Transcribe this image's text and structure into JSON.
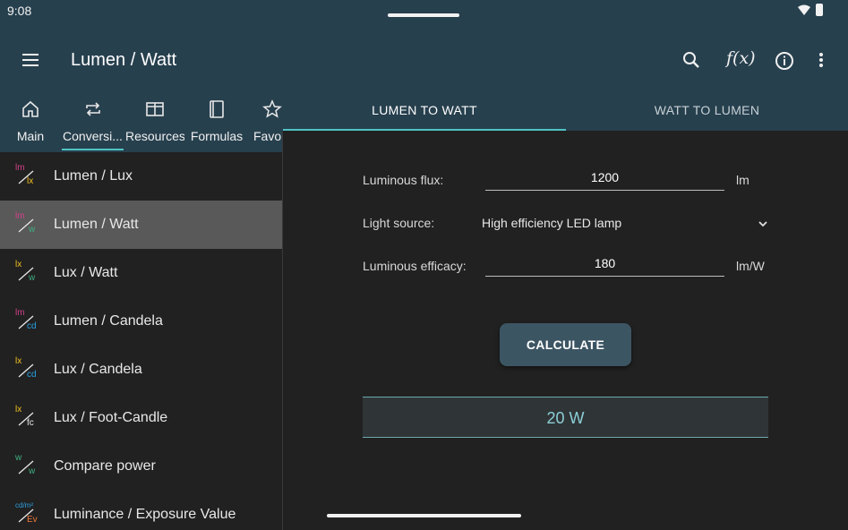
{
  "status": {
    "time": "9:08"
  },
  "app": {
    "title": "Lumen / Watt",
    "fx_label": "f(x)"
  },
  "nav_tabs": [
    {
      "label": "Main",
      "icon": "home-icon"
    },
    {
      "label": "Conversi...",
      "icon": "repeat-icon",
      "active": true
    },
    {
      "label": "Resources",
      "icon": "table-icon"
    },
    {
      "label": "Formulas",
      "icon": "book-icon"
    },
    {
      "label": "Favor",
      "icon": "star-icon"
    }
  ],
  "sub_tabs": [
    {
      "label": "LUMEN TO WATT",
      "active": true
    },
    {
      "label": "WATT TO LUMEN"
    }
  ],
  "sidebar": {
    "items": [
      {
        "label": "Lumen / Lux",
        "top": "lm",
        "bottom": "lx",
        "top_color": "#d0408a",
        "bottom_color": "#f0c020"
      },
      {
        "label": "Lumen / Watt",
        "top": "lm",
        "bottom": "w",
        "top_color": "#d0408a",
        "bottom_color": "#3fae80",
        "selected": true
      },
      {
        "label": "Lux / Watt",
        "top": "lx",
        "bottom": "w",
        "top_color": "#f0c020",
        "bottom_color": "#3fae80"
      },
      {
        "label": "Lumen / Candela",
        "top": "lm",
        "bottom": "cd",
        "top_color": "#d0408a",
        "bottom_color": "#2a9fe0"
      },
      {
        "label": "Lux / Candela",
        "top": "lx",
        "bottom": "cd",
        "top_color": "#f0c020",
        "bottom_color": "#2a9fe0"
      },
      {
        "label": "Lux / Foot-Candle",
        "top": "lx",
        "bottom": "fc",
        "top_color": "#f0c020",
        "bottom_color": "#e8e8e8"
      },
      {
        "label": "Compare power",
        "top": "w",
        "bottom": "w",
        "top_color": "#3fae80",
        "bottom_color": "#3fae80"
      },
      {
        "label": "Luminance / Exposure Value",
        "top": "cd/m²",
        "bottom": "Ev",
        "top_color": "#2a9fe0",
        "bottom_color": "#ef7a3a"
      }
    ]
  },
  "form": {
    "flux_label": "Luminous flux:",
    "flux_value": "1200",
    "flux_unit": "lm",
    "source_label": "Light source:",
    "source_value": "High efficiency LED lamp",
    "efficacy_label": "Luminous efficacy:",
    "efficacy_value": "180",
    "efficacy_unit": "lm/W",
    "calculate_label": "CALCULATE",
    "result": "20 W"
  }
}
